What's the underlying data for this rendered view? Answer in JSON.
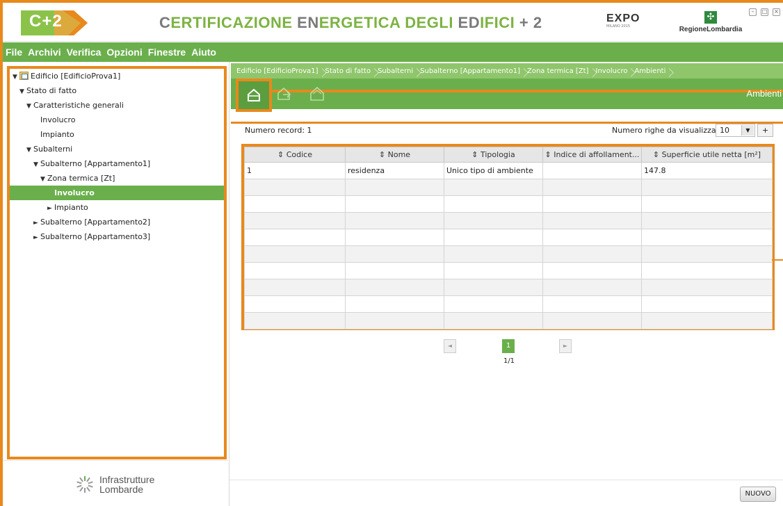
{
  "header": {
    "logo_text": "C+2",
    "title_parts": [
      {
        "text": "C",
        "accent": false
      },
      {
        "text": "ERTIFICAZIONE ",
        "accent": true
      },
      {
        "text": "EN",
        "accent": false
      },
      {
        "text": "ERGETICA DEGLI ",
        "accent": true
      },
      {
        "text": "ED",
        "accent": false
      },
      {
        "text": "IFICI",
        "accent": true
      },
      {
        "text": " + 2",
        "accent": false
      }
    ],
    "expo_text": "EXPO",
    "expo_sub": "MILANO 2015",
    "region_text": "RegioneLombardia"
  },
  "menu": [
    "File",
    "Archivi",
    "Verifica",
    "Opzioni",
    "Finestre",
    "Aiuto"
  ],
  "tree": [
    {
      "label": "Edificio [EdificioProva1]",
      "indent": 0,
      "arrow": "▼",
      "icon": true
    },
    {
      "label": "Stato di fatto",
      "indent": 1,
      "arrow": "▼"
    },
    {
      "label": "Caratteristiche generali",
      "indent": 2,
      "arrow": "▼"
    },
    {
      "label": "Involucro",
      "indent": 3,
      "arrow": ""
    },
    {
      "label": "Impianto",
      "indent": 3,
      "arrow": ""
    },
    {
      "label": "Subalterni",
      "indent": 2,
      "arrow": "▼"
    },
    {
      "label": "Subalterno [Appartamento1]",
      "indent": 3,
      "arrow": "▼"
    },
    {
      "label": "Zona termica [Zt]",
      "indent": 4,
      "arrow": "▼"
    },
    {
      "label": "Involucro",
      "indent": 5,
      "arrow": "",
      "selected": true
    },
    {
      "label": "Impianto",
      "indent": 5,
      "arrow": "►"
    },
    {
      "label": "Subalterno [Appartamento2]",
      "indent": 3,
      "arrow": "►"
    },
    {
      "label": "Subalterno [Appartamento3]",
      "indent": 3,
      "arrow": "►"
    }
  ],
  "footer_logo": {
    "line1": "Infrastrutture",
    "line2": "Lombarde"
  },
  "breadcrumb": [
    "Edificio [EdificioProva1]",
    "Stato di fatto",
    "Subalterni",
    "Subalterno [Appartamento1]",
    "Zona termica [Zt]",
    "Involucro",
    "Ambienti"
  ],
  "toolbar": {
    "title": "Ambienti"
  },
  "record_count_label": "Numero record: 1",
  "rows_label": "Numero righe da visualizzare:",
  "rows_value": "10",
  "rows_add": "+",
  "grid": {
    "columns": [
      "⇕ Codice",
      "⇕ Nome",
      "⇕ Tipologia",
      "⇕ Indice di affollament...",
      "⇕ Superficie utile netta [m²]"
    ],
    "rows": [
      [
        "1",
        "residenza",
        "Unico tipo di ambiente",
        "",
        "147.8"
      ]
    ],
    "empty_rows": 9
  },
  "pager": {
    "prev": "◄",
    "next": "►",
    "page": "1",
    "info": "1/1"
  },
  "nuovo_label": "NUOVO",
  "colors": {
    "green": "#6aaf4c",
    "orange": "#e8891d"
  }
}
